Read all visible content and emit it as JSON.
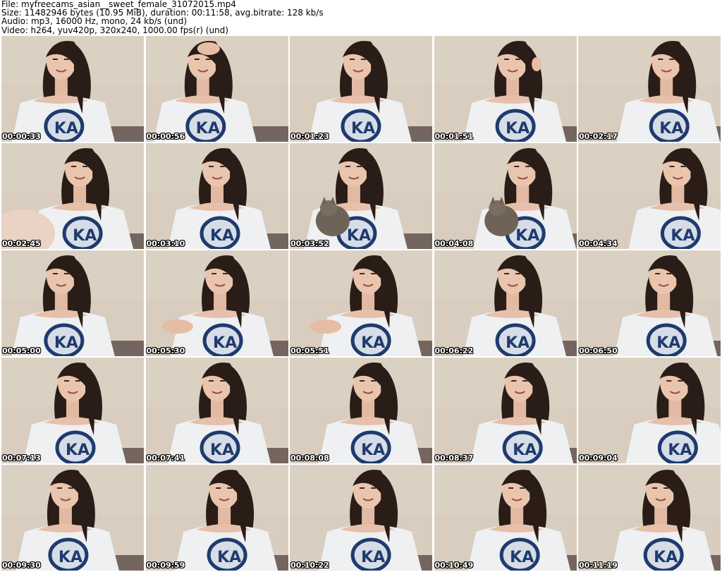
{
  "header": {
    "file": "File: myfreecams_asian__sweet_female_31072015.mp4",
    "size": "Size: 11482946 bytes (10.95 MiB), duration: 00:11:58, avg.bitrate: 128 kb/s",
    "audio": "Audio: mp3, 16000 Hz, mono, 24 kb/s (und)",
    "video": "Video: h264, yuv420p, 320x240, 1000.00 fps(r) (und)"
  },
  "thumbnails": [
    {
      "time": "00:00:33"
    },
    {
      "time": "00:00:56"
    },
    {
      "time": "00:01:23"
    },
    {
      "time": "00:01:51"
    },
    {
      "time": "00:02:17"
    },
    {
      "time": "00:02:45"
    },
    {
      "time": "00:03:10"
    },
    {
      "time": "00:03:52"
    },
    {
      "time": "00:04:08"
    },
    {
      "time": "00:04:34"
    },
    {
      "time": "00:05:00"
    },
    {
      "time": "00:05:30"
    },
    {
      "time": "00:05:51"
    },
    {
      "time": "00:06:22"
    },
    {
      "time": "00:06:50"
    },
    {
      "time": "00:07:13"
    },
    {
      "time": "00:07:41"
    },
    {
      "time": "00:08:08"
    },
    {
      "time": "00:08:37"
    },
    {
      "time": "00:09:04"
    },
    {
      "time": "00:09:30"
    },
    {
      "time": "00:09:59"
    },
    {
      "time": "00:10:22"
    },
    {
      "time": "00:10:49"
    },
    {
      "time": "00:11:19"
    }
  ]
}
